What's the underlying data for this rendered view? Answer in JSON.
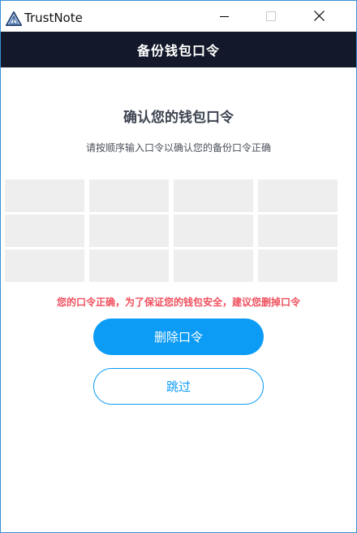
{
  "window": {
    "title": "TrustNote",
    "icons": {
      "app": "trustnote-logo-icon",
      "minimize": "minimize-icon",
      "maximize": "maximize-icon",
      "close": "close-icon"
    }
  },
  "header": {
    "title": "备份钱包口令"
  },
  "main": {
    "title": "确认您的钱包口令",
    "subtitle": "请按顺序输入口令以确认您的备份口令正确",
    "word_slots": [
      "",
      "",
      "",
      "",
      "",
      "",
      "",
      "",
      "",
      "",
      "",
      ""
    ],
    "warning": "您的口令正确，为了保证您的钱包安全，建议您删掉口令",
    "delete_button": "删除口令",
    "skip_button": "跳过"
  },
  "colors": {
    "header_bg": "#13192a",
    "primary": "#0c9cf6",
    "warning": "#ef4f5d",
    "slot_bg": "#eeeeee"
  }
}
